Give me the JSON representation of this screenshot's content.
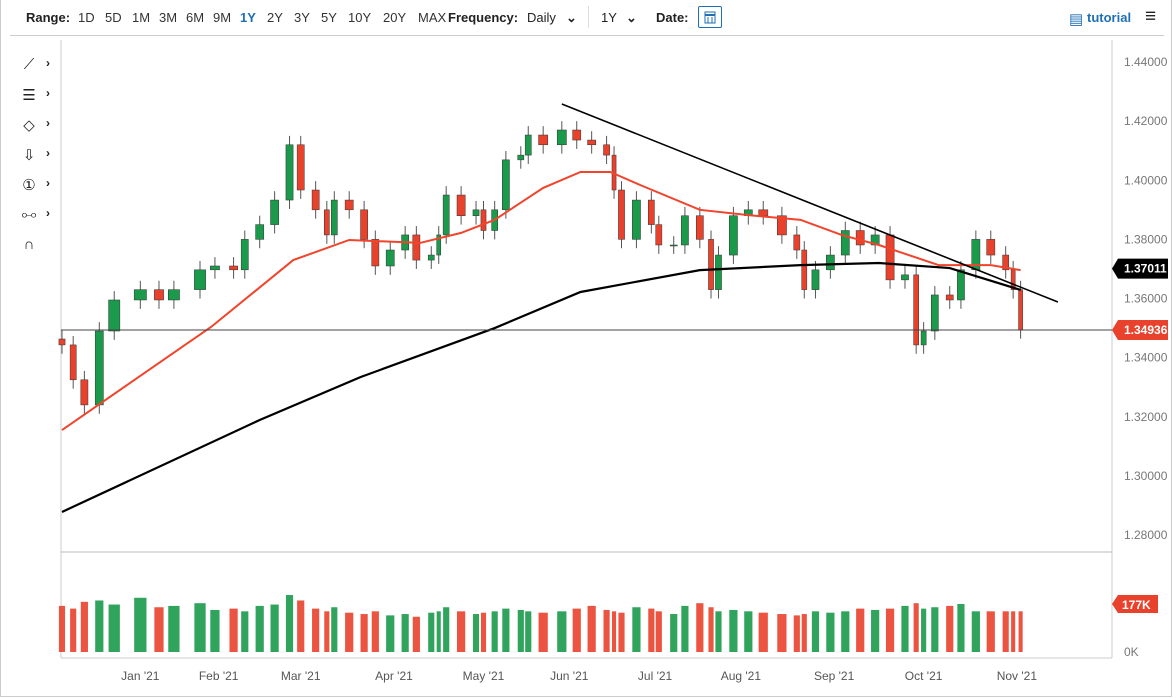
{
  "toolbar": {
    "range_label": "Range:",
    "ranges": [
      "1D",
      "5D",
      "1M",
      "3M",
      "6M",
      "9M",
      "1Y",
      "2Y",
      "3Y",
      "5Y",
      "10Y",
      "20Y",
      "MAX"
    ],
    "active_range": "1Y",
    "frequency_label": "Frequency:",
    "frequency_value": "Daily",
    "period_value": "1Y",
    "date_label": "Date:",
    "tutorial_label": "tutorial"
  },
  "tools": [
    "line-tool-icon",
    "fib-tool-icon",
    "shape-tool-icon",
    "arrow-tool-icon",
    "annotation-tool-icon",
    "measure-tool-icon",
    "magnet-icon"
  ],
  "colors": {
    "up": "#1a9a4a",
    "down": "#e8412c",
    "ma_short": "#f0442c",
    "ma_long": "#000000",
    "accent": "#1f6fb5"
  },
  "chart_data": {
    "type": "candlestick",
    "ylim": [
      1.27,
      1.445
    ],
    "yticks": [
      "1.44000",
      "1.42000",
      "1.40000",
      "1.38000",
      "1.36000",
      "1.34000",
      "1.32000",
      "1.30000",
      "1.28000"
    ],
    "ytick_values": [
      1.44,
      1.42,
      1.4,
      1.38,
      1.36,
      1.34,
      1.32,
      1.3,
      1.28
    ],
    "xticks": [
      {
        "i": 21,
        "label": "Jan '21"
      },
      {
        "i": 42,
        "label": "Feb '21"
      },
      {
        "i": 64,
        "label": "Mar '21"
      },
      {
        "i": 89,
        "label": "Apr '21"
      },
      {
        "i": 113,
        "label": "May '21"
      },
      {
        "i": 136,
        "label": "Jun '21"
      },
      {
        "i": 159,
        "label": "Jul '21"
      },
      {
        "i": 182,
        "label": "Aug '21"
      },
      {
        "i": 207,
        "label": "Sep '21"
      },
      {
        "i": 231,
        "label": "Oct '21"
      },
      {
        "i": 256,
        "label": "Nov '21"
      }
    ],
    "closes": [
      [
        0,
        1.3443
      ],
      [
        3,
        1.3325
      ],
      [
        6,
        1.324
      ],
      [
        10,
        1.349
      ],
      [
        14,
        1.3595
      ],
      [
        21,
        1.363
      ],
      [
        26,
        1.3595
      ],
      [
        30,
        1.363
      ],
      [
        37,
        1.3697
      ],
      [
        41,
        1.371
      ],
      [
        46,
        1.3697
      ],
      [
        49,
        1.38
      ],
      [
        53,
        1.385
      ],
      [
        57,
        1.3933
      ],
      [
        61,
        1.412
      ],
      [
        64,
        1.3967
      ],
      [
        68,
        1.39
      ],
      [
        71,
        1.3815
      ],
      [
        73,
        1.3933
      ],
      [
        77,
        1.39
      ],
      [
        81,
        1.38
      ],
      [
        84,
        1.371
      ],
      [
        88,
        1.3764
      ],
      [
        92,
        1.3815
      ],
      [
        95,
        1.373
      ],
      [
        99,
        1.3747
      ],
      [
        101,
        1.3815
      ],
      [
        103,
        1.395
      ],
      [
        107,
        1.388
      ],
      [
        111,
        1.39
      ],
      [
        113,
        1.383
      ],
      [
        116,
        1.39
      ],
      [
        119,
        1.4069
      ],
      [
        123,
        1.4085
      ],
      [
        125,
        1.4153
      ],
      [
        129,
        1.412
      ],
      [
        134,
        1.417
      ],
      [
        138,
        1.4136
      ],
      [
        142,
        1.412
      ],
      [
        146,
        1.4085
      ],
      [
        148,
        1.3967
      ],
      [
        150,
        1.38
      ],
      [
        154,
        1.3933
      ],
      [
        158,
        1.385
      ],
      [
        160,
        1.3781
      ],
      [
        164,
        1.3781
      ],
      [
        167,
        1.388
      ],
      [
        171,
        1.38
      ],
      [
        174,
        1.363
      ],
      [
        176,
        1.3747
      ],
      [
        180,
        1.388
      ],
      [
        184,
        1.39
      ],
      [
        188,
        1.388
      ],
      [
        193,
        1.3815
      ],
      [
        197,
        1.3764
      ],
      [
        199,
        1.363
      ],
      [
        202,
        1.3697
      ],
      [
        206,
        1.3747
      ],
      [
        210,
        1.383
      ],
      [
        214,
        1.3781
      ],
      [
        218,
        1.3815
      ],
      [
        222,
        1.3663
      ],
      [
        226,
        1.368
      ],
      [
        229,
        1.3443
      ],
      [
        231,
        1.349
      ],
      [
        234,
        1.3612
      ],
      [
        238,
        1.3595
      ],
      [
        241,
        1.3697
      ],
      [
        245,
        1.38
      ],
      [
        249,
        1.3747
      ],
      [
        253,
        1.3697
      ],
      [
        255,
        1.363
      ],
      [
        257,
        1.3494
      ]
    ],
    "ma_short": [
      [
        0,
        1.3155
      ],
      [
        26,
        1.3382
      ],
      [
        40,
        1.3504
      ],
      [
        62,
        1.373
      ],
      [
        77,
        1.3798
      ],
      [
        96,
        1.3788
      ],
      [
        107,
        1.3822
      ],
      [
        116,
        1.3866
      ],
      [
        129,
        1.3974
      ],
      [
        139,
        1.4028
      ],
      [
        147,
        1.4028
      ],
      [
        155,
        1.3984
      ],
      [
        171,
        1.39
      ],
      [
        184,
        1.3882
      ],
      [
        198,
        1.3866
      ],
      [
        209,
        1.3815
      ],
      [
        219,
        1.3781
      ],
      [
        235,
        1.3713
      ],
      [
        249,
        1.3713
      ],
      [
        257,
        1.3696
      ]
    ],
    "ma_long": [
      [
        0,
        1.2878
      ],
      [
        53,
        1.3189
      ],
      [
        80,
        1.3334
      ],
      [
        116,
        1.35
      ],
      [
        139,
        1.3622
      ],
      [
        171,
        1.3696
      ],
      [
        198,
        1.3713
      ],
      [
        219,
        1.372
      ],
      [
        238,
        1.3703
      ],
      [
        257,
        1.3629
      ]
    ],
    "trendline": [
      [
        134,
        1.4258
      ],
      [
        267,
        1.3588
      ]
    ],
    "hline": 1.34936,
    "last_ma_label": "1.37011",
    "last_ma_value": 1.37011,
    "last_price_label": "1.34936",
    "volume_k": [
      170,
      160,
      185,
      190,
      175,
      200,
      165,
      170,
      180,
      155,
      160,
      150,
      170,
      175,
      210,
      190,
      160,
      150,
      165,
      145,
      140,
      150,
      135,
      140,
      130,
      145,
      150,
      165,
      150,
      140,
      145,
      150,
      160,
      155,
      150,
      145,
      150,
      160,
      170,
      155,
      150,
      145,
      165,
      160,
      150,
      140,
      170,
      180,
      165,
      150,
      155,
      150,
      145,
      140,
      135,
      140,
      150,
      145,
      150,
      160,
      155,
      160,
      170,
      180,
      160,
      165,
      170,
      177
    ],
    "volume_max_k": 300,
    "volume_ticks": [
      "177K",
      "0K"
    ]
  }
}
